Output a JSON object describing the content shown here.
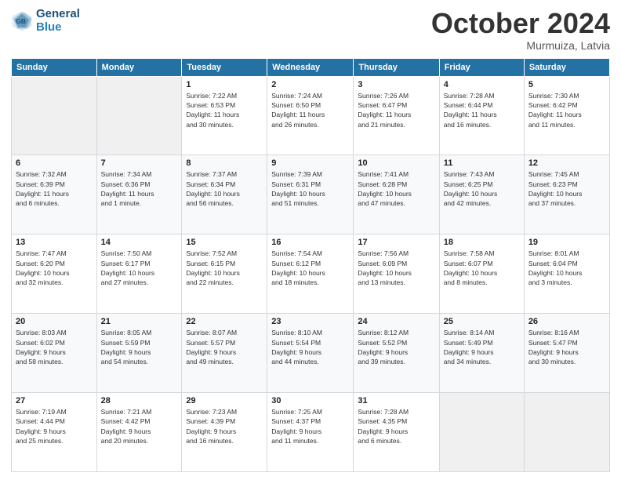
{
  "header": {
    "logo_line1": "General",
    "logo_line2": "Blue",
    "month_title": "October 2024",
    "subtitle": "Murmuiza, Latvia"
  },
  "weekdays": [
    "Sunday",
    "Monday",
    "Tuesday",
    "Wednesday",
    "Thursday",
    "Friday",
    "Saturday"
  ],
  "weeks": [
    [
      {
        "day": "",
        "info": ""
      },
      {
        "day": "",
        "info": ""
      },
      {
        "day": "1",
        "info": "Sunrise: 7:22 AM\nSunset: 6:53 PM\nDaylight: 11 hours\nand 30 minutes."
      },
      {
        "day": "2",
        "info": "Sunrise: 7:24 AM\nSunset: 6:50 PM\nDaylight: 11 hours\nand 26 minutes."
      },
      {
        "day": "3",
        "info": "Sunrise: 7:26 AM\nSunset: 6:47 PM\nDaylight: 11 hours\nand 21 minutes."
      },
      {
        "day": "4",
        "info": "Sunrise: 7:28 AM\nSunset: 6:44 PM\nDaylight: 11 hours\nand 16 minutes."
      },
      {
        "day": "5",
        "info": "Sunrise: 7:30 AM\nSunset: 6:42 PM\nDaylight: 11 hours\nand 11 minutes."
      }
    ],
    [
      {
        "day": "6",
        "info": "Sunrise: 7:32 AM\nSunset: 6:39 PM\nDaylight: 11 hours\nand 6 minutes."
      },
      {
        "day": "7",
        "info": "Sunrise: 7:34 AM\nSunset: 6:36 PM\nDaylight: 11 hours\nand 1 minute."
      },
      {
        "day": "8",
        "info": "Sunrise: 7:37 AM\nSunset: 6:34 PM\nDaylight: 10 hours\nand 56 minutes."
      },
      {
        "day": "9",
        "info": "Sunrise: 7:39 AM\nSunset: 6:31 PM\nDaylight: 10 hours\nand 51 minutes."
      },
      {
        "day": "10",
        "info": "Sunrise: 7:41 AM\nSunset: 6:28 PM\nDaylight: 10 hours\nand 47 minutes."
      },
      {
        "day": "11",
        "info": "Sunrise: 7:43 AM\nSunset: 6:25 PM\nDaylight: 10 hours\nand 42 minutes."
      },
      {
        "day": "12",
        "info": "Sunrise: 7:45 AM\nSunset: 6:23 PM\nDaylight: 10 hours\nand 37 minutes."
      }
    ],
    [
      {
        "day": "13",
        "info": "Sunrise: 7:47 AM\nSunset: 6:20 PM\nDaylight: 10 hours\nand 32 minutes."
      },
      {
        "day": "14",
        "info": "Sunrise: 7:50 AM\nSunset: 6:17 PM\nDaylight: 10 hours\nand 27 minutes."
      },
      {
        "day": "15",
        "info": "Sunrise: 7:52 AM\nSunset: 6:15 PM\nDaylight: 10 hours\nand 22 minutes."
      },
      {
        "day": "16",
        "info": "Sunrise: 7:54 AM\nSunset: 6:12 PM\nDaylight: 10 hours\nand 18 minutes."
      },
      {
        "day": "17",
        "info": "Sunrise: 7:56 AM\nSunset: 6:09 PM\nDaylight: 10 hours\nand 13 minutes."
      },
      {
        "day": "18",
        "info": "Sunrise: 7:58 AM\nSunset: 6:07 PM\nDaylight: 10 hours\nand 8 minutes."
      },
      {
        "day": "19",
        "info": "Sunrise: 8:01 AM\nSunset: 6:04 PM\nDaylight: 10 hours\nand 3 minutes."
      }
    ],
    [
      {
        "day": "20",
        "info": "Sunrise: 8:03 AM\nSunset: 6:02 PM\nDaylight: 9 hours\nand 58 minutes."
      },
      {
        "day": "21",
        "info": "Sunrise: 8:05 AM\nSunset: 5:59 PM\nDaylight: 9 hours\nand 54 minutes."
      },
      {
        "day": "22",
        "info": "Sunrise: 8:07 AM\nSunset: 5:57 PM\nDaylight: 9 hours\nand 49 minutes."
      },
      {
        "day": "23",
        "info": "Sunrise: 8:10 AM\nSunset: 5:54 PM\nDaylight: 9 hours\nand 44 minutes."
      },
      {
        "day": "24",
        "info": "Sunrise: 8:12 AM\nSunset: 5:52 PM\nDaylight: 9 hours\nand 39 minutes."
      },
      {
        "day": "25",
        "info": "Sunrise: 8:14 AM\nSunset: 5:49 PM\nDaylight: 9 hours\nand 34 minutes."
      },
      {
        "day": "26",
        "info": "Sunrise: 8:16 AM\nSunset: 5:47 PM\nDaylight: 9 hours\nand 30 minutes."
      }
    ],
    [
      {
        "day": "27",
        "info": "Sunrise: 7:19 AM\nSunset: 4:44 PM\nDaylight: 9 hours\nand 25 minutes."
      },
      {
        "day": "28",
        "info": "Sunrise: 7:21 AM\nSunset: 4:42 PM\nDaylight: 9 hours\nand 20 minutes."
      },
      {
        "day": "29",
        "info": "Sunrise: 7:23 AM\nSunset: 4:39 PM\nDaylight: 9 hours\nand 16 minutes."
      },
      {
        "day": "30",
        "info": "Sunrise: 7:25 AM\nSunset: 4:37 PM\nDaylight: 9 hours\nand 11 minutes."
      },
      {
        "day": "31",
        "info": "Sunrise: 7:28 AM\nSunset: 4:35 PM\nDaylight: 9 hours\nand 6 minutes."
      },
      {
        "day": "",
        "info": ""
      },
      {
        "day": "",
        "info": ""
      }
    ]
  ]
}
